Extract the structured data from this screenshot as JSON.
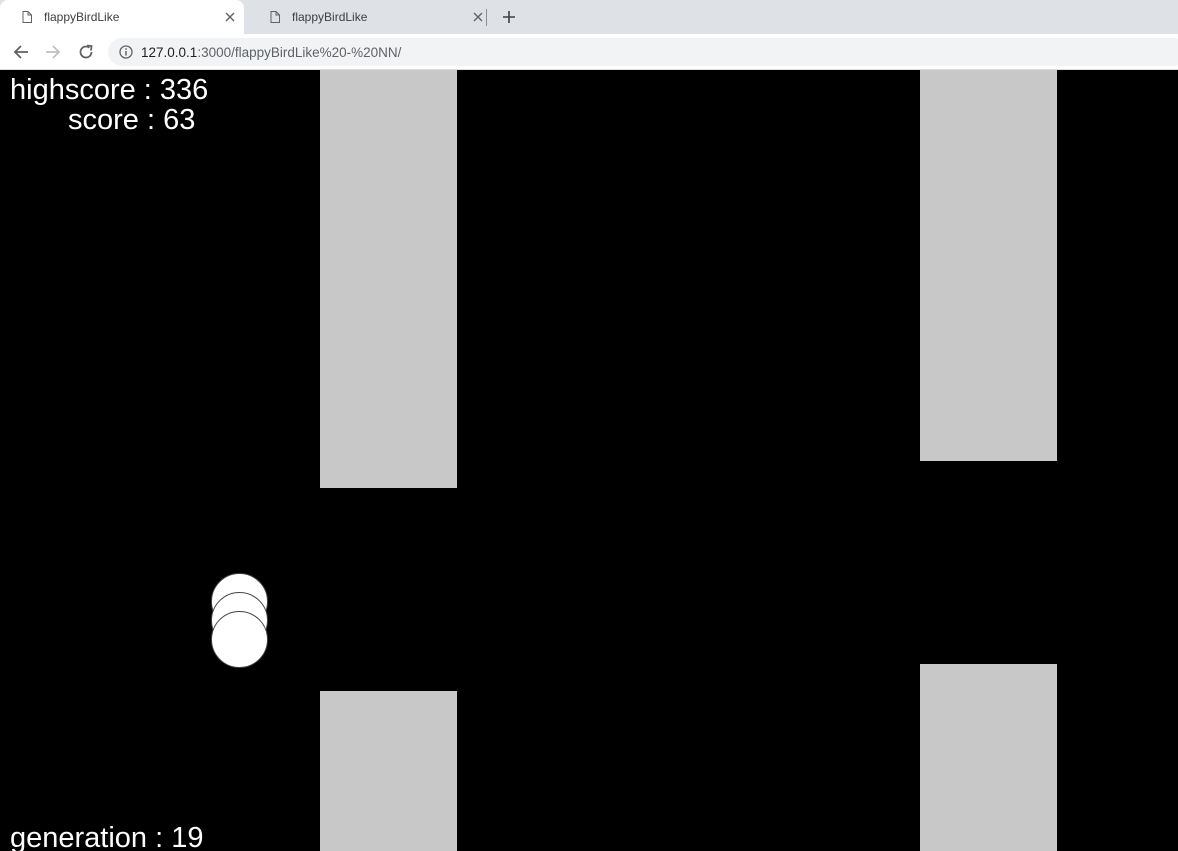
{
  "browser": {
    "tabs": [
      {
        "title": "flappyBirdLike",
        "active": true
      },
      {
        "title": "flappyBirdLike",
        "active": false
      }
    ],
    "url_host": "127.0.0.1",
    "url_rest": ":3000/flappyBirdLike%20-%20NN/"
  },
  "game": {
    "highscore_label": "highscore : 336",
    "score_label": "score : 63",
    "generation_label": "generation : 19",
    "highscore": 336,
    "score": 63,
    "generation": 19,
    "colors": {
      "background": "#000000",
      "pipe": "#c8c8c8",
      "bird": "#ffffff",
      "text": "#ffffff"
    }
  }
}
